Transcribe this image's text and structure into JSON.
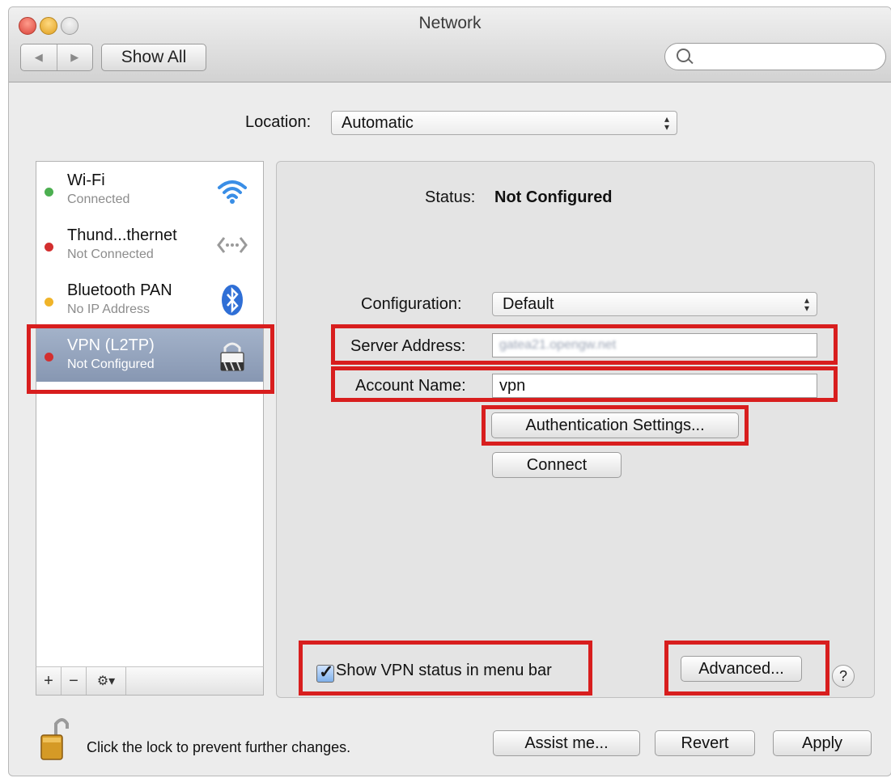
{
  "window": {
    "title": "Network"
  },
  "toolbar": {
    "back_label": "◀",
    "forward_label": "▶",
    "show_all_label": "Show All",
    "search_placeholder": ""
  },
  "location": {
    "label": "Location:",
    "value": "Automatic"
  },
  "services": [
    {
      "name": "Wi-Fi",
      "status": "Connected",
      "dot_color": "#4caf50",
      "icon": "wifi-icon"
    },
    {
      "name": "Thund...thernet",
      "status": "Not Connected",
      "dot_color": "#d32f2f",
      "icon": "ethernet-icon"
    },
    {
      "name": "Bluetooth PAN",
      "status": "No IP Address",
      "dot_color": "#f0b429",
      "icon": "bluetooth-icon"
    },
    {
      "name": "VPN (L2TP)",
      "status": "Not Configured",
      "dot_color": "#d32f2f",
      "icon": "vpn-lock-icon",
      "selected": true
    }
  ],
  "sidebar_buttons": {
    "add": "+",
    "remove": "−",
    "gear": "⚙▾"
  },
  "detail": {
    "status_label": "Status:",
    "status_value": "Not Configured",
    "configuration_label": "Configuration:",
    "configuration_value": "Default",
    "server_address_label": "Server Address:",
    "server_address_value": "gatea21.opengw.net",
    "account_name_label": "Account Name:",
    "account_name_value": "vpn",
    "auth_settings_label": "Authentication Settings...",
    "connect_label": "Connect",
    "show_vpn_status_label": "Show VPN status in menu bar",
    "advanced_label": "Advanced...",
    "help_label": "?"
  },
  "footer": {
    "lock_text": "Click the lock to prevent further changes.",
    "assist_label": "Assist me...",
    "revert_label": "Revert",
    "apply_label": "Apply"
  },
  "colors": {
    "highlight": "#d81e1e",
    "selection": "#8797b2"
  }
}
